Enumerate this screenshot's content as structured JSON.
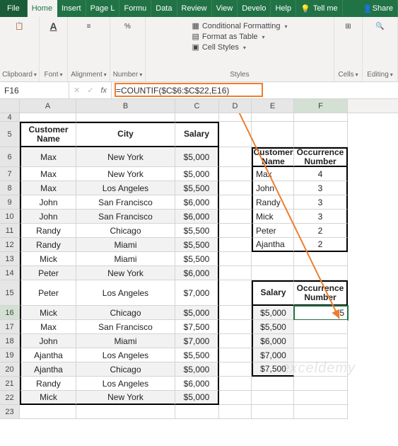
{
  "ribbon": {
    "tabs": [
      "File",
      "Home",
      "Insert",
      "Page L",
      "Formu",
      "Data",
      "Review",
      "View",
      "Develo",
      "Help"
    ],
    "tellme": "Tell me",
    "share": "Share",
    "groups": {
      "clipboard": "Clipboard",
      "font": "Font",
      "alignment": "Alignment",
      "number": "Number",
      "styles": "Styles",
      "cells": "Cells",
      "editing": "Editing"
    },
    "styles_items": [
      "Conditional Formatting",
      "Format as Table",
      "Cell Styles"
    ]
  },
  "name_box": "F16",
  "formula": "=COUNTIF($C$6:$C$22,E16)",
  "col_labels": [
    "A",
    "B",
    "C",
    "D",
    "E",
    "F"
  ],
  "main_table": {
    "headers": [
      "Customer Name",
      "City",
      "Salary"
    ],
    "rows": [
      [
        "Max",
        "New York",
        "$5,000"
      ],
      [
        "Max",
        "New York",
        "$5,000"
      ],
      [
        "Max",
        "Los Angeles",
        "$5,500"
      ],
      [
        "John",
        "San Francisco",
        "$6,000"
      ],
      [
        "John",
        "San Francisco",
        "$6,000"
      ],
      [
        "Randy",
        "Chicago",
        "$5,500"
      ],
      [
        "Randy",
        "Miami",
        "$5,500"
      ],
      [
        "Mick",
        "Miami",
        "$5,500"
      ],
      [
        "Peter",
        "New York",
        "$6,000"
      ],
      [
        "Peter",
        "Los Angeles",
        "$7,000"
      ],
      [
        "Mick",
        "Chicago",
        "$5,000"
      ],
      [
        "Max",
        "San Francisco",
        "$7,500"
      ],
      [
        "John",
        "Miami",
        "$7,000"
      ],
      [
        "Ajantha",
        "Los Angeles",
        "$5,500"
      ],
      [
        "Ajantha",
        "Chicago",
        "$5,000"
      ],
      [
        "Randy",
        "Los Angeles",
        "$6,000"
      ],
      [
        "Mick",
        "New York",
        "$5,000"
      ]
    ]
  },
  "cust_table": {
    "headers": [
      "Customer Name",
      "Occurrence Number"
    ],
    "rows": [
      [
        "Max",
        "4"
      ],
      [
        "John",
        "3"
      ],
      [
        "Randy",
        "3"
      ],
      [
        "Mick",
        "3"
      ],
      [
        "Peter",
        "2"
      ],
      [
        "Ajantha",
        "2"
      ]
    ]
  },
  "salary_table": {
    "headers": [
      "Salary",
      "Occurrence Number"
    ],
    "rows": [
      [
        "$5,000",
        "5"
      ],
      [
        "$5,500",
        ""
      ],
      [
        "$6,000",
        ""
      ],
      [
        "$7,000",
        ""
      ],
      [
        "$7,500",
        ""
      ]
    ]
  },
  "row_numbers": [
    4,
    5,
    6,
    7,
    8,
    9,
    10,
    11,
    12,
    13,
    14,
    15,
    16,
    17,
    18,
    19,
    20,
    21,
    22,
    23
  ],
  "watermark": "exceldemy"
}
